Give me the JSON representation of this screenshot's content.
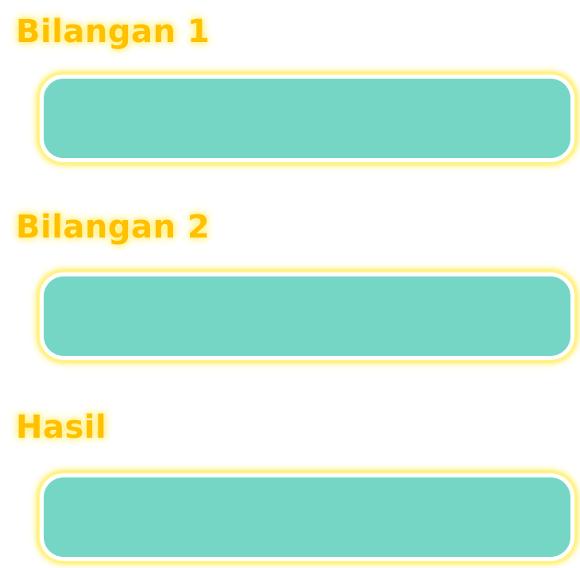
{
  "form": {
    "fields": [
      {
        "label": "Bilangan 1",
        "value": "",
        "placeholder": ""
      },
      {
        "label": "Bilangan 2",
        "value": "",
        "placeholder": ""
      },
      {
        "label": "Hasil",
        "value": "",
        "placeholder": ""
      }
    ]
  },
  "colors": {
    "label": "#FFC000",
    "glow": "#FFEB55",
    "field_fill": "#76D6C6",
    "background": "#FFFFFF"
  }
}
